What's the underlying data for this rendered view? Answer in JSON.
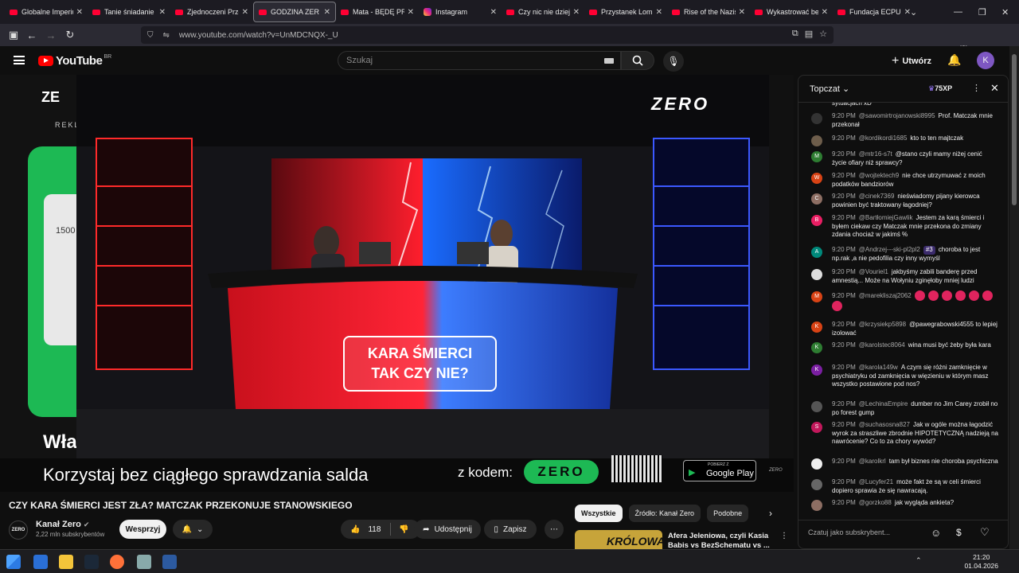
{
  "browser": {
    "tabs": [
      {
        "title": "Globalne Imperium",
        "icon": "youtube"
      },
      {
        "title": "Tanie śniadanie w",
        "icon": "youtube"
      },
      {
        "title": "Zjednoczeni Przec",
        "icon": "youtube"
      },
      {
        "title": "GODZINA ZER",
        "icon": "youtube",
        "active": true
      },
      {
        "title": "Mata - BĘDĘ PREZ",
        "icon": "youtube"
      },
      {
        "title": "Instagram",
        "icon": "instagram"
      },
      {
        "title": "Czy nic nie dzieje",
        "icon": "youtube"
      },
      {
        "title": "Przystanek Lomba",
        "icon": "youtube"
      },
      {
        "title": "Rise of the Nazis a",
        "icon": "youtube"
      },
      {
        "title": "Wykastrować bez",
        "icon": "youtube"
      },
      {
        "title": "Fundacja ECPU Po",
        "icon": "youtube"
      }
    ],
    "url": "www.youtube.com/watch?v=UnMDCNQX-_U",
    "ext_badge": "270"
  },
  "youtube": {
    "logo_text": "YouTube",
    "country": "BR",
    "search_placeholder": "Szukaj",
    "create_label": "Utwórz",
    "avatar_letter": "K"
  },
  "video": {
    "overlay_line1": "KARA ŚMIERCI",
    "overlay_line2": "TAK CZY NIE?",
    "channel_logo": "ZERO",
    "ad_bottom_text": "Korzystaj bez ciągłego sprawdzania salda",
    "ad_code_label": "z kodem:",
    "ad_code": "ZERO",
    "ad_store": "Google Play",
    "ad_store_small": "POBIERZ Z",
    "ad_left_text": "Wła",
    "ad_left_top": "ZE",
    "ad_left_sub": "REKL",
    "ad_left_num": "1500",
    "ad_corner": "ZERO"
  },
  "meta": {
    "title": "CZY KARA ŚMIERCI JEST ZŁA? MATCZAK PRZEKONUJE STANOWSKIEGO",
    "channel": "Kanał Zero",
    "subs": "2,22 mln subskrybentów",
    "support": "Wesprzyj",
    "likes": "118",
    "share": "Udostępnij",
    "save": "Zapisz",
    "channel_avatar": "ZERO"
  },
  "chips": [
    "Wszystkie",
    "Źródło: Kanał Zero",
    "Podobne"
  ],
  "recommendation": {
    "title": "Afera Jeleniowa, czyli Kasia Babis vs BezSchematu vs ...",
    "thumb_text": "KRÓLOWA"
  },
  "chat": {
    "mode": "Topczat",
    "points": "75XP",
    "input_placeholder": "Czatuj jako subskrybent...",
    "messages": [
      {
        "time": "",
        "author": "",
        "text": "sytuacjach xD",
        "color": "#555"
      },
      {
        "time": "9:20 PM",
        "author": "@sawomirtrojanowski8995",
        "text": "Prof. Matczak mnie przekonał",
        "color": "#333",
        "av": ""
      },
      {
        "time": "9:20 PM",
        "author": "@kordikordi1685",
        "text": "kto to ten majtczak",
        "color": "#6d5d4b",
        "av": ""
      },
      {
        "time": "9:20 PM",
        "author": "@mtr16-s7t",
        "text": "@stano czyli mamy niżej cenić życie ofiary niż sprawcy?",
        "color": "#2e7d32",
        "av": "M"
      },
      {
        "time": "9:20 PM",
        "author": "@wojtektech9",
        "text": "nie chce utrzymuwać z moich podatków bandziorów",
        "color": "#d84315",
        "av": "W"
      },
      {
        "time": "9:20 PM",
        "author": "@cinek7369",
        "text": "nieświadomy pijany kierowca powinien być traktowany łagodniej?",
        "color": "#8d6e63",
        "av": "C"
      },
      {
        "time": "9:20 PM",
        "author": "@BartłomiejGawlik",
        "text": "Jestem za karą śmierci i byłem ciekaw czy Matczak mnie przekona do zmiany zdania chociaż w jakimś %",
        "color": "#e91e63",
        "av": "B"
      },
      {
        "time": "9:20 PM",
        "author": "@Andrzej---ski-pl2pl2",
        "badge": "#3",
        "text": "choroba to jest np.rak ,a nie pedofilia czy inny wymyśl",
        "color": "#00897b",
        "av": "A"
      },
      {
        "time": "9:20 PM",
        "author": "@Vouriel1",
        "text": "jakbyśmy zabili banderę przed amnestią... Może na Wołyniu zginęłoby mniej ludzi",
        "color": "#ddd",
        "av": ""
      },
      {
        "time": "9:20 PM",
        "author": "@marekliszaj2062",
        "text": "",
        "emotes": 7,
        "color": "#d84315",
        "av": "M"
      },
      {
        "time": "9:20 PM",
        "author": "@krzysiekp5898",
        "text": "@pawegrabowski4555 to lepiej izolować",
        "color": "#d84315",
        "av": "K"
      },
      {
        "time": "9:20 PM",
        "author": "@karolstec8064",
        "text": "wina musi być żeby była kara",
        "color": "#2e7d32",
        "av": "K"
      },
      {
        "time": "9:20 PM",
        "author": "@karola149w",
        "text": "A czym się różni zamknięcie w psychiatryku od zamknięcia w więzieniu w którym masz wszystko postawione pod nos?",
        "color": "#7b1fa2",
        "av": "K"
      },
      {
        "time": "9:20 PM",
        "author": "@LechinaEmpire",
        "text": "dumber no Jim Carey zrobił no po forest gump",
        "color": "#555",
        "av": ""
      },
      {
        "time": "9:20 PM",
        "author": "@suchasosna827",
        "text": "Jak w ogóle można łagodzić wyrok za straszliwe zbrodnie HIPOTETYCZNĄ nadzieją na nawrócenie? Co to za chory wywód?",
        "color": "#c2185b",
        "av": "S"
      },
      {
        "time": "9:20 PM",
        "author": "@karolkrl",
        "text": "tam był biznes nie choroba psychiczna",
        "color": "#eee",
        "av": ""
      },
      {
        "time": "9:20 PM",
        "author": "@Lucyfer21",
        "text": "może fakt że są w celi śmierci dopiero sprawia że się nawracają.",
        "color": "#666",
        "av": ""
      },
      {
        "time": "9:20 PM",
        "author": "@gorzko88",
        "text": "jak wygląda ankieta?",
        "color": "#8d6e63",
        "av": ""
      }
    ]
  },
  "taskbar": {
    "time": "21:20",
    "date": "01.04.2026"
  }
}
